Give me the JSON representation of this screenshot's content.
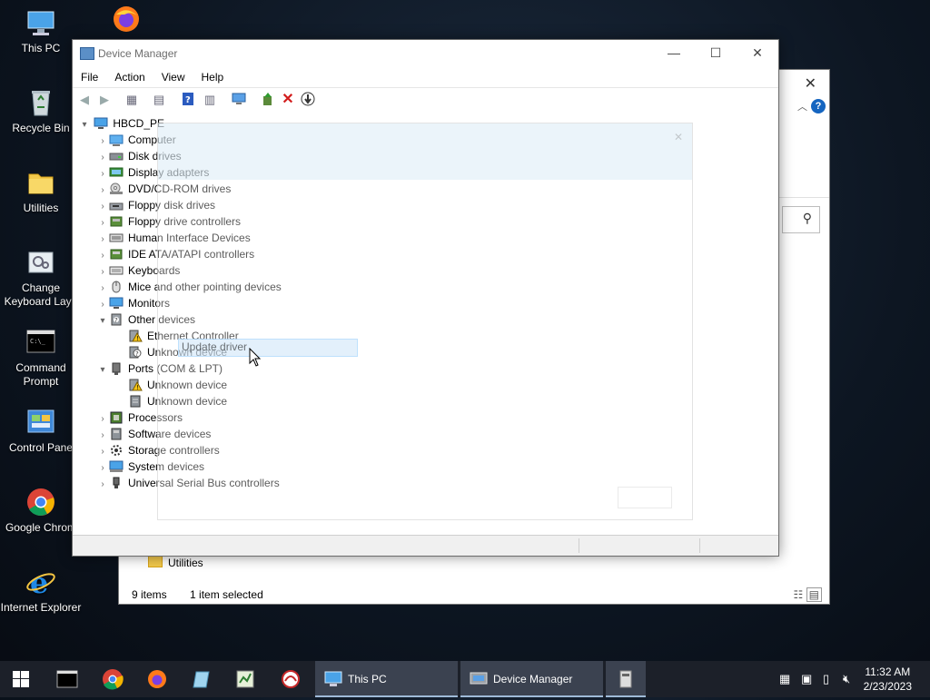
{
  "desktop": {
    "icons": [
      {
        "label": "This PC",
        "icon": "computer-icon"
      },
      {
        "label": "Recycle Bin",
        "icon": "recycle-bin-icon"
      },
      {
        "label": "Utilities",
        "icon": "folder-icon"
      },
      {
        "label": "Change Keyboard Layo",
        "icon": "keyboard-settings-icon"
      },
      {
        "label": "Command Prompt",
        "icon": "cmd-icon"
      },
      {
        "label": "Control Pane",
        "icon": "control-panel-icon"
      },
      {
        "label": "Google Chrom",
        "icon": "chrome-icon"
      },
      {
        "label": "Internet Explorer",
        "icon": "ie-icon"
      }
    ],
    "top_icon": "firefox-icon"
  },
  "explorer": {
    "utilities_label": "Utilities",
    "items_count": "9 items",
    "selection": "1 item selected"
  },
  "device_manager": {
    "title": "Device Manager",
    "menu": [
      "File",
      "Action",
      "View",
      "Help"
    ],
    "toolbar_icons": [
      "back-icon",
      "forward-icon",
      "properties-sheet-icon",
      "list-icon",
      "help-icon",
      "details-icon",
      "scan-hardware-icon",
      "update-driver-icon",
      "uninstall-icon",
      "disable-icon"
    ],
    "root": "HBCD_PE",
    "tree": [
      {
        "label": "Computer",
        "icon": "computer-icon",
        "state": "collapsed"
      },
      {
        "label": "Disk drives",
        "icon": "disk-drive-icon",
        "state": "collapsed"
      },
      {
        "label": "Display adapters",
        "icon": "display-adapter-icon",
        "state": "collapsed"
      },
      {
        "label": "DVD/CD-ROM drives",
        "icon": "dvd-drive-icon",
        "state": "collapsed"
      },
      {
        "label": "Floppy disk drives",
        "icon": "floppy-icon",
        "state": "collapsed"
      },
      {
        "label": "Floppy drive controllers",
        "icon": "controller-icon",
        "state": "collapsed"
      },
      {
        "label": "Human Interface Devices",
        "icon": "hid-icon",
        "state": "collapsed"
      },
      {
        "label": "IDE ATA/ATAPI controllers",
        "icon": "ide-controller-icon",
        "state": "collapsed"
      },
      {
        "label": "Keyboards",
        "icon": "keyboard-icon",
        "state": "collapsed"
      },
      {
        "label": "Mice and other pointing devices",
        "icon": "mouse-icon",
        "state": "collapsed"
      },
      {
        "label": "Monitors",
        "icon": "monitor-icon",
        "state": "collapsed"
      },
      {
        "label": "Other devices",
        "icon": "unknown-device-icon",
        "state": "expanded",
        "children": [
          {
            "label": "Ethernet Controller",
            "icon": "warning-device-icon"
          },
          {
            "label": "Unknown device",
            "icon": "unknown-device-icon"
          }
        ]
      },
      {
        "label": "Ports (COM & LPT)",
        "icon": "port-icon",
        "state": "expanded",
        "children": [
          {
            "label": "Unknown device",
            "icon": "warning-device-icon"
          },
          {
            "label": "Unknown device",
            "icon": "port-device-icon"
          }
        ]
      },
      {
        "label": "Processors",
        "icon": "processor-icon",
        "state": "collapsed"
      },
      {
        "label": "Software devices",
        "icon": "software-device-icon",
        "state": "collapsed"
      },
      {
        "label": "Storage controllers",
        "icon": "storage-controller-icon",
        "state": "collapsed"
      },
      {
        "label": "System devices",
        "icon": "system-device-icon",
        "state": "collapsed"
      },
      {
        "label": "Universal Serial Bus controllers",
        "icon": "usb-icon",
        "state": "collapsed"
      }
    ]
  },
  "context_menu": {
    "item": "Update driver"
  },
  "taskbar": {
    "pinned": [
      "cmd-icon",
      "chrome-icon",
      "firefox-icon",
      "notepad-icon",
      "registry-icon",
      "tool-icon"
    ],
    "buttons": [
      {
        "label": "This PC",
        "icon": "computer-icon"
      },
      {
        "label": "Device Manager",
        "icon": "device-manager-icon"
      }
    ],
    "time": "11:32 AM",
    "date": "2/23/2023"
  },
  "colors": {
    "accent": "#0078d7",
    "taskbar": "#1c2029",
    "warning": "#f5c518"
  }
}
